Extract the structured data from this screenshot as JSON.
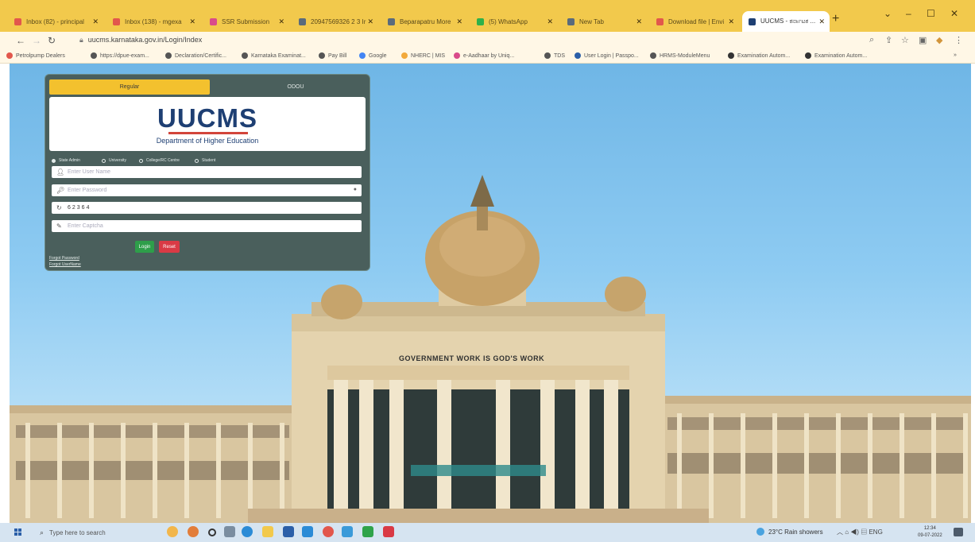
{
  "browser": {
    "tabs": [
      {
        "label": "Inbox (82) - principal",
        "favicon_color": "#e2574c",
        "active": false
      },
      {
        "label": "Inbox (138) - mgexa",
        "favicon_color": "#e2574c",
        "active": false
      },
      {
        "label": "SSR Submission",
        "favicon_color": "#d94b8a",
        "active": false
      },
      {
        "label": "20947569326 2 3 Ir",
        "favicon_color": "#5a6b7c",
        "active": false
      },
      {
        "label": "Beparapatru More",
        "favicon_color": "#5a6b7c",
        "active": false
      },
      {
        "label": "(5) WhatsApp",
        "favicon_color": "#2fb14a",
        "active": false
      },
      {
        "label": "New Tab",
        "favicon_color": "#5a6b7c",
        "active": false
      },
      {
        "label": "Download file | Envi",
        "favicon_color": "#e2574c",
        "active": false
      },
      {
        "label": "UUCMS - ಕರ್ನಾಟಕ ...",
        "favicon_color": "#1e3f73",
        "active": true
      }
    ],
    "url": "uucms.karnataka.gov.in/Login/Index",
    "bookmarks": [
      {
        "label": "Petrolpump Dealers",
        "color": "#e2574c"
      },
      {
        "label": "https://dpue-exam...",
        "color": "#555555"
      },
      {
        "label": "Declaration/Certific...",
        "color": "#555555"
      },
      {
        "label": "Karnataka Examinat...",
        "color": "#555555"
      },
      {
        "label": "Pay Bill",
        "color": "#555555"
      },
      {
        "label": "Google",
        "color": "#4285f4"
      },
      {
        "label": "NHERC | MIS",
        "color": "#f2a93b"
      },
      {
        "label": "e-Aadhaar by Uniq...",
        "color": "#d94b8a"
      },
      {
        "label": "TDS",
        "color": "#555555"
      },
      {
        "label": "User Login | Passpo...",
        "color": "#2b5fa8"
      },
      {
        "label": "HRMS-ModuleMenu",
        "color": "#555555"
      },
      {
        "label": "Examination Autom...",
        "color": "#333333"
      },
      {
        "label": "Examination Autom...",
        "color": "#333333"
      }
    ]
  },
  "login": {
    "tabs": [
      "Regular",
      "ODOU"
    ],
    "logo": "UUCMS",
    "logo_sub": "Department of Higher Education",
    "radios": [
      "State Admin",
      "University",
      "College/RC Centre",
      "Student"
    ],
    "username_placeholder": "Enter User Name",
    "password_placeholder": "Enter Password",
    "captcha_value": "62364",
    "captcha_placeholder": "Enter Captcha",
    "login_label": "Login",
    "reset_label": "Reset",
    "forgot_password": "Forgot Password",
    "forgot_username": "Forgot UserName"
  },
  "building": {
    "inscription": "GOVERNMENT WORK IS GOD'S WORK"
  },
  "taskbar": {
    "search_placeholder": "Type here to search",
    "weather": "23°C Rain showers",
    "language": "ENG",
    "time": "12:34",
    "date": "09-07-2022"
  }
}
